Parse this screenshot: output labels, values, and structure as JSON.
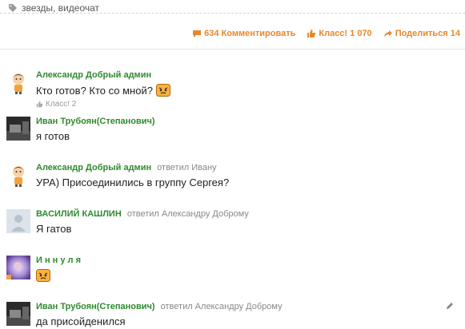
{
  "tags": {
    "label": "звезды, видеочат"
  },
  "actions": {
    "comment": "634 Комментировать",
    "klass": "Класс! 1 070",
    "share": "Поделиться 14"
  },
  "comments": [
    {
      "author": "Александр Добрый админ",
      "reply_to": "",
      "text": "Кто готов? Кто со мной?",
      "klass": "Класс! 2"
    },
    {
      "author": "Иван Трубоян(Степанович)",
      "reply_to": "",
      "text": "я готов"
    },
    {
      "author": "Александр Добрый админ",
      "reply_to": "ответил Ивану",
      "text": "УРА) Присоединились в группу Сергея?"
    },
    {
      "author": "ВАСИЛИЙ КАШЛИН",
      "reply_to": "ответил Александру Доброму",
      "text": "Я гатов"
    },
    {
      "author": "И н н у л я",
      "reply_to": "",
      "text": ""
    },
    {
      "author": "Иван Трубоян(Степанович)",
      "reply_to": "ответил Александру Доброму",
      "text": "да присойденился"
    }
  ],
  "colors": {
    "accent": "#e8872a",
    "author": "#2e8b2e"
  },
  "icons": [
    "tag-icon",
    "comment-icon",
    "like-icon",
    "share-icon",
    "emoji-icon",
    "edit-icon"
  ]
}
